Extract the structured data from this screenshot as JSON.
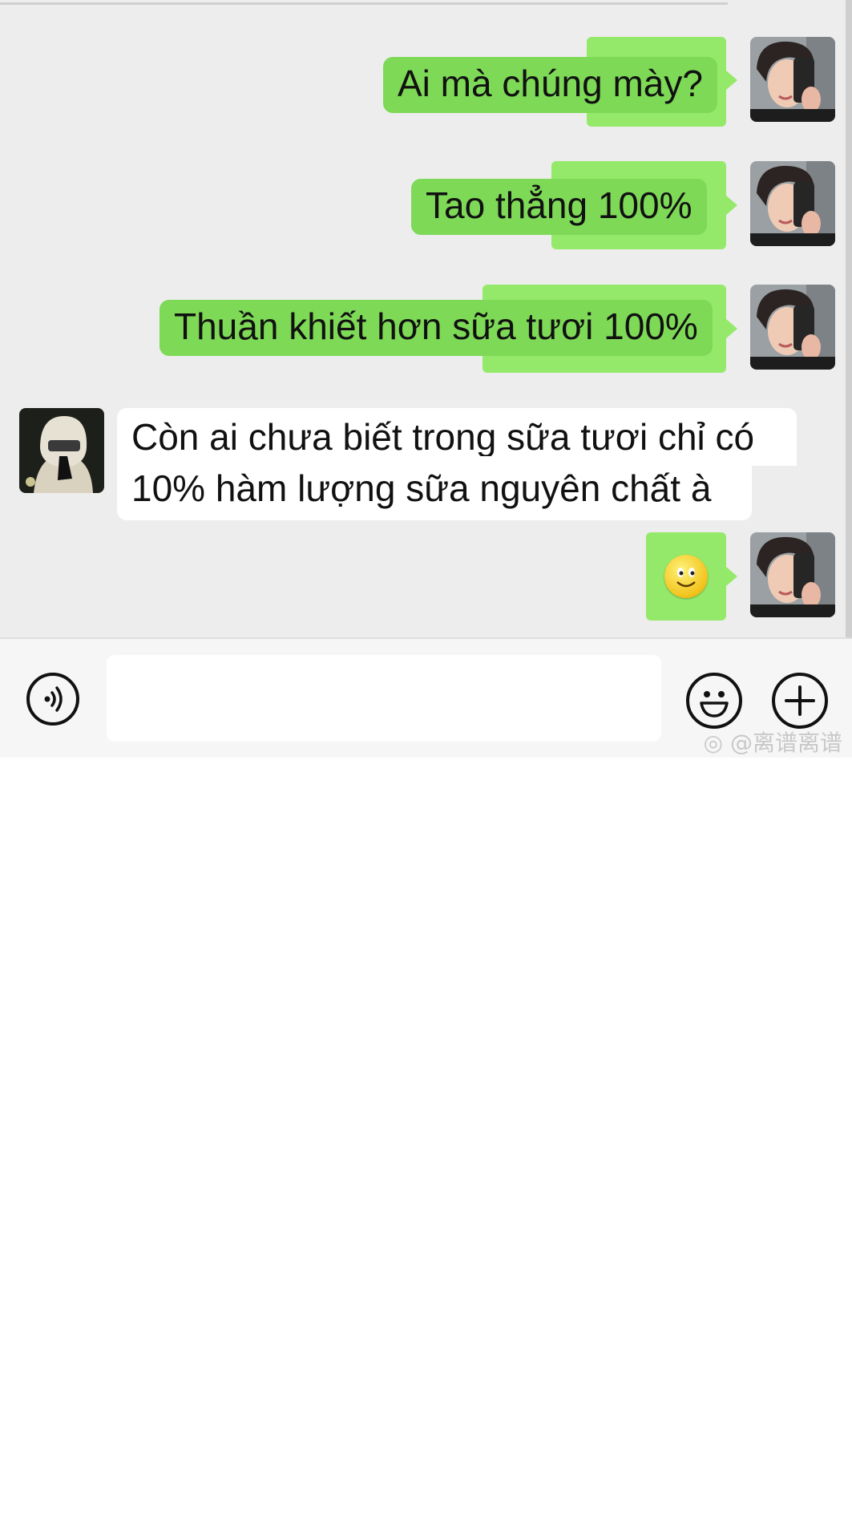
{
  "messages": [
    {
      "side": "out",
      "text": "Ai mà chúng mày?"
    },
    {
      "side": "out",
      "text": "Tao thẳng 100%"
    },
    {
      "side": "out",
      "text": "Thuần khiết hơn sữa tươi 100%"
    },
    {
      "side": "in",
      "lines": [
        "Còn ai chưa biết trong sữa tươi chỉ có",
        "10% hàm lượng sữa nguyên chất à"
      ]
    },
    {
      "side": "out",
      "emoji": "smiley-face-emoji"
    }
  ],
  "input_bar": {
    "voice_icon": "voice-icon",
    "message_placeholder": "",
    "emoji_icon": "emoji-icon",
    "plus_icon": "plus-icon"
  },
  "watermark": "@离谱离谱",
  "colors": {
    "chat_background": "#ededed",
    "outgoing_bubble": "#7ed957",
    "incoming_bubble": "#ffffff"
  }
}
